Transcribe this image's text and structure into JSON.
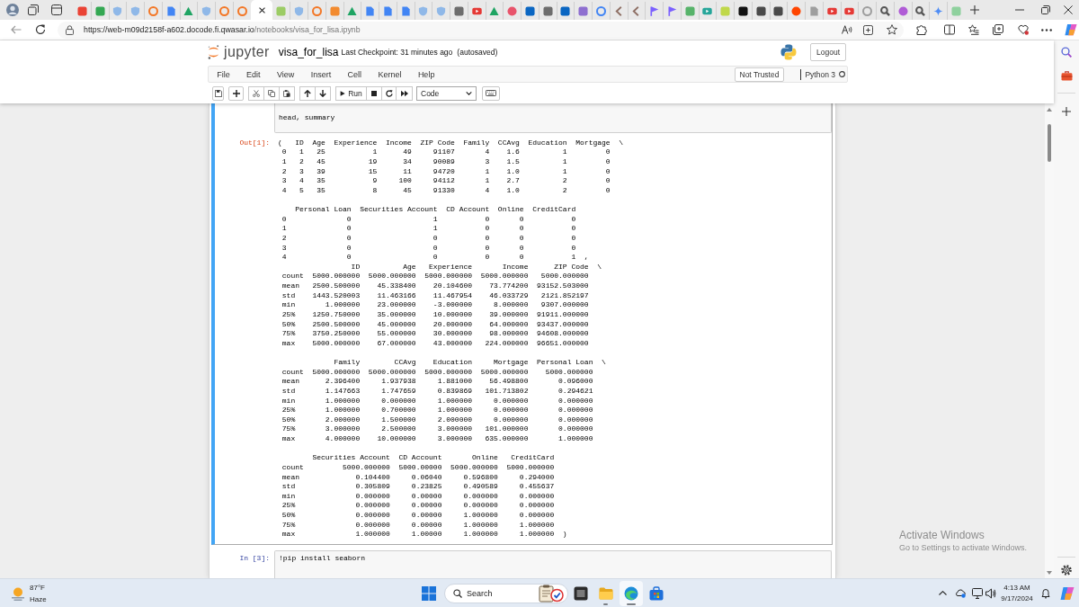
{
  "browser": {
    "tabs": [
      {
        "kind": "tile",
        "color": "#ea4335",
        "selected": false
      },
      {
        "kind": "tile",
        "color": "#34a853",
        "selected": false
      },
      {
        "kind": "shield",
        "color": "#8fb8e8",
        "selected": false
      },
      {
        "kind": "shield",
        "color": "#8fb8e8",
        "selected": false
      },
      {
        "kind": "ring",
        "color": "#f37726",
        "selected": false
      },
      {
        "kind": "page",
        "color": "#4285f4",
        "selected": false
      },
      {
        "kind": "triangle",
        "color": "#1fa463",
        "selected": false
      },
      {
        "kind": "shield",
        "color": "#8fb8e8",
        "selected": false
      },
      {
        "kind": "ring",
        "color": "#f37726",
        "selected": false
      },
      {
        "kind": "ring",
        "color": "#f37726",
        "selected": false
      },
      {
        "selected": true
      },
      {
        "kind": "tile",
        "color": "#9ccc65",
        "selected": false
      },
      {
        "kind": "shield",
        "color": "#8fb8e8",
        "selected": false
      },
      {
        "kind": "ring",
        "color": "#f37726",
        "selected": false
      },
      {
        "kind": "tile",
        "color": "#f28b30",
        "selected": false
      },
      {
        "kind": "triangle",
        "color": "#1fa463",
        "selected": false
      },
      {
        "kind": "page",
        "color": "#4285f4",
        "selected": false
      },
      {
        "kind": "page",
        "color": "#4285f4",
        "selected": false
      },
      {
        "kind": "page",
        "color": "#4285f4",
        "selected": false
      },
      {
        "kind": "shield",
        "color": "#8fb8e8",
        "selected": false
      },
      {
        "kind": "shield",
        "color": "#8fb8e8",
        "selected": false
      },
      {
        "kind": "tile",
        "color": "#6d6d6d",
        "selected": false
      },
      {
        "kind": "play",
        "color": "#e53935",
        "selected": false
      },
      {
        "kind": "triangle",
        "color": "#1fa463",
        "selected": false
      },
      {
        "kind": "circle",
        "color": "#e8546b",
        "selected": false
      },
      {
        "kind": "tile",
        "color": "#0a66c2",
        "selected": false
      },
      {
        "kind": "tile",
        "color": "#6d6d6d",
        "selected": false
      },
      {
        "kind": "tile",
        "color": "#0a66c2",
        "selected": false
      },
      {
        "kind": "tile",
        "color": "#8e6fd0",
        "selected": false
      },
      {
        "kind": "ring",
        "color": "#4285f4",
        "selected": false
      },
      {
        "kind": "chevron",
        "color": "#8d6e63",
        "selected": false
      },
      {
        "kind": "chevron",
        "color": "#8d6e63",
        "selected": false
      },
      {
        "kind": "flag",
        "color": "#7b61ff",
        "selected": false
      },
      {
        "kind": "flag",
        "color": "#7b61ff",
        "selected": false
      },
      {
        "kind": "tile",
        "color": "#57b36a",
        "selected": false
      },
      {
        "kind": "play",
        "color": "#26a69a",
        "selected": false
      },
      {
        "kind": "tile",
        "color": "#c0d84a",
        "selected": false
      },
      {
        "kind": "tile",
        "color": "#111111",
        "selected": false
      },
      {
        "kind": "tile",
        "color": "#4a4a4a",
        "selected": false
      },
      {
        "kind": "tile",
        "color": "#4a4a4a",
        "selected": false
      },
      {
        "kind": "circle",
        "color": "#ff4500",
        "selected": false
      },
      {
        "kind": "page",
        "color": "#9e9e9e",
        "selected": false
      },
      {
        "kind": "play",
        "color": "#e53935",
        "selected": false
      },
      {
        "kind": "play",
        "color": "#e53935",
        "selected": false
      },
      {
        "kind": "ring",
        "color": "#9e9e9e",
        "selected": false
      },
      {
        "kind": "search",
        "color": "#555555",
        "selected": false
      },
      {
        "kind": "circle",
        "color": "#b05cd6",
        "selected": false
      },
      {
        "kind": "search",
        "color": "#555555",
        "selected": false
      },
      {
        "kind": "sparkle",
        "color": "#4f8df5",
        "selected": false
      },
      {
        "kind": "tile",
        "color": "#8fd19e",
        "selected": false
      }
    ],
    "address": {
      "host": "https://web-m09d2158f-a602.docode.fi.qwasar.io",
      "path": "/notebooks/visa_for_lisa.ipynb"
    }
  },
  "jupyter": {
    "logo_text": "jupyter",
    "notebook_name": "visa_for_lisa",
    "checkpoint": "Last Checkpoint: 31 minutes ago",
    "autosave_status": "(autosaved)",
    "logout": "Logout",
    "menu": [
      "File",
      "Edit",
      "View",
      "Insert",
      "Cell",
      "Kernel",
      "Help"
    ],
    "trust_status": "Not Trusted",
    "kernel": "Python 3",
    "toolbar": {
      "run_label": "Run",
      "cell_type": "Code"
    }
  },
  "cells": [
    {
      "kind": "code",
      "selected": true,
      "input": "head, summary",
      "output": {
        "prompt": "Out[1]:",
        "blocks": [
          [
            "(   ID  Age  Experience  Income  ZIP Code  Family  CCAvg  Education  Mortgage  \\",
            " 0   1   25           1      49     91107       4    1.6          1         0",
            " 1   2   45          19      34     90089       3    1.5          1         0",
            " 2   3   39          15      11     94720       1    1.0          1         0",
            " 3   4   35           9     100     94112       1    2.7          2         0",
            " 4   5   35           8      45     91330       4    1.0          2         0"
          ],
          [
            "    Personal Loan  Securities Account  CD Account  Online  CreditCard",
            " 0              0                   1           0       0           0",
            " 1              0                   1           0       0           0",
            " 2              0                   0           0       0           0",
            " 3              0                   0           0       0           0",
            " 4              0                   0           0       0           1  ,",
            "                 ID          Age   Experience       Income      ZIP Code  \\",
            " count  5000.000000  5000.000000  5000.000000  5000.000000   5000.000000",
            " mean   2500.500000    45.338400    20.104600    73.774200  93152.503000",
            " std    1443.520003    11.463166    11.467954    46.033729   2121.852197",
            " min       1.000000    23.000000    -3.000000     8.000000   9307.000000",
            " 25%    1250.750000    35.000000    10.000000    39.000000  91911.000000",
            " 50%    2500.500000    45.000000    20.000000    64.000000  93437.000000",
            " 75%    3750.250000    55.000000    30.000000    98.000000  94608.000000",
            " max    5000.000000    67.000000    43.000000   224.000000  96651.000000"
          ],
          [
            "             Family        CCAvg    Education     Mortgage  Personal Loan  \\",
            " count  5000.000000  5000.000000  5000.000000  5000.000000    5000.000000",
            " mean      2.396400     1.937938     1.881000    56.498800       0.096000",
            " std       1.147663     1.747659     0.839869   101.713802       0.294621",
            " min       1.000000     0.000000     1.000000     0.000000       0.000000",
            " 25%       1.000000     0.700000     1.000000     0.000000       0.000000",
            " 50%       2.000000     1.500000     2.000000     0.000000       0.000000",
            " 75%       3.000000     2.500000     3.000000   101.000000       0.000000",
            " max       4.000000    10.000000     3.000000   635.000000       1.000000"
          ],
          [
            "        Securities Account  CD Account       Online   CreditCard",
            " count         5000.000000  5000.00000  5000.000000  5000.000000",
            " mean             0.104400     0.06040     0.596800     0.294000",
            " std              0.305809     0.23825     0.490589     0.455637",
            " min              0.000000     0.00000     0.000000     0.000000",
            " 25%              0.000000     0.00000     0.000000     0.000000",
            " 50%              0.000000     0.00000     1.000000     0.000000",
            " 75%              0.000000     0.00000     1.000000     1.000000",
            " max              1.000000     1.00000     1.000000     1.000000  )"
          ]
        ]
      }
    },
    {
      "kind": "code",
      "selected": false,
      "prompt": "In [3]:",
      "input": "!pip install seaborn"
    }
  ],
  "windows_activation": {
    "title": "Activate Windows",
    "message": "Go to Settings to activate Windows."
  },
  "taskbar": {
    "weather": {
      "temperature": "87°F",
      "condition": "Haze"
    },
    "search": {
      "placeholder": "Search"
    },
    "apps": [
      {
        "kind": "window",
        "running": false,
        "selected": false
      },
      {
        "kind": "folder",
        "running": true,
        "selected": false
      },
      {
        "kind": "browser",
        "running": true,
        "selected": true
      },
      {
        "kind": "store",
        "running": false,
        "selected": false
      }
    ],
    "clock": {
      "time": "4:13 AM",
      "date": "9/17/2024"
    }
  }
}
